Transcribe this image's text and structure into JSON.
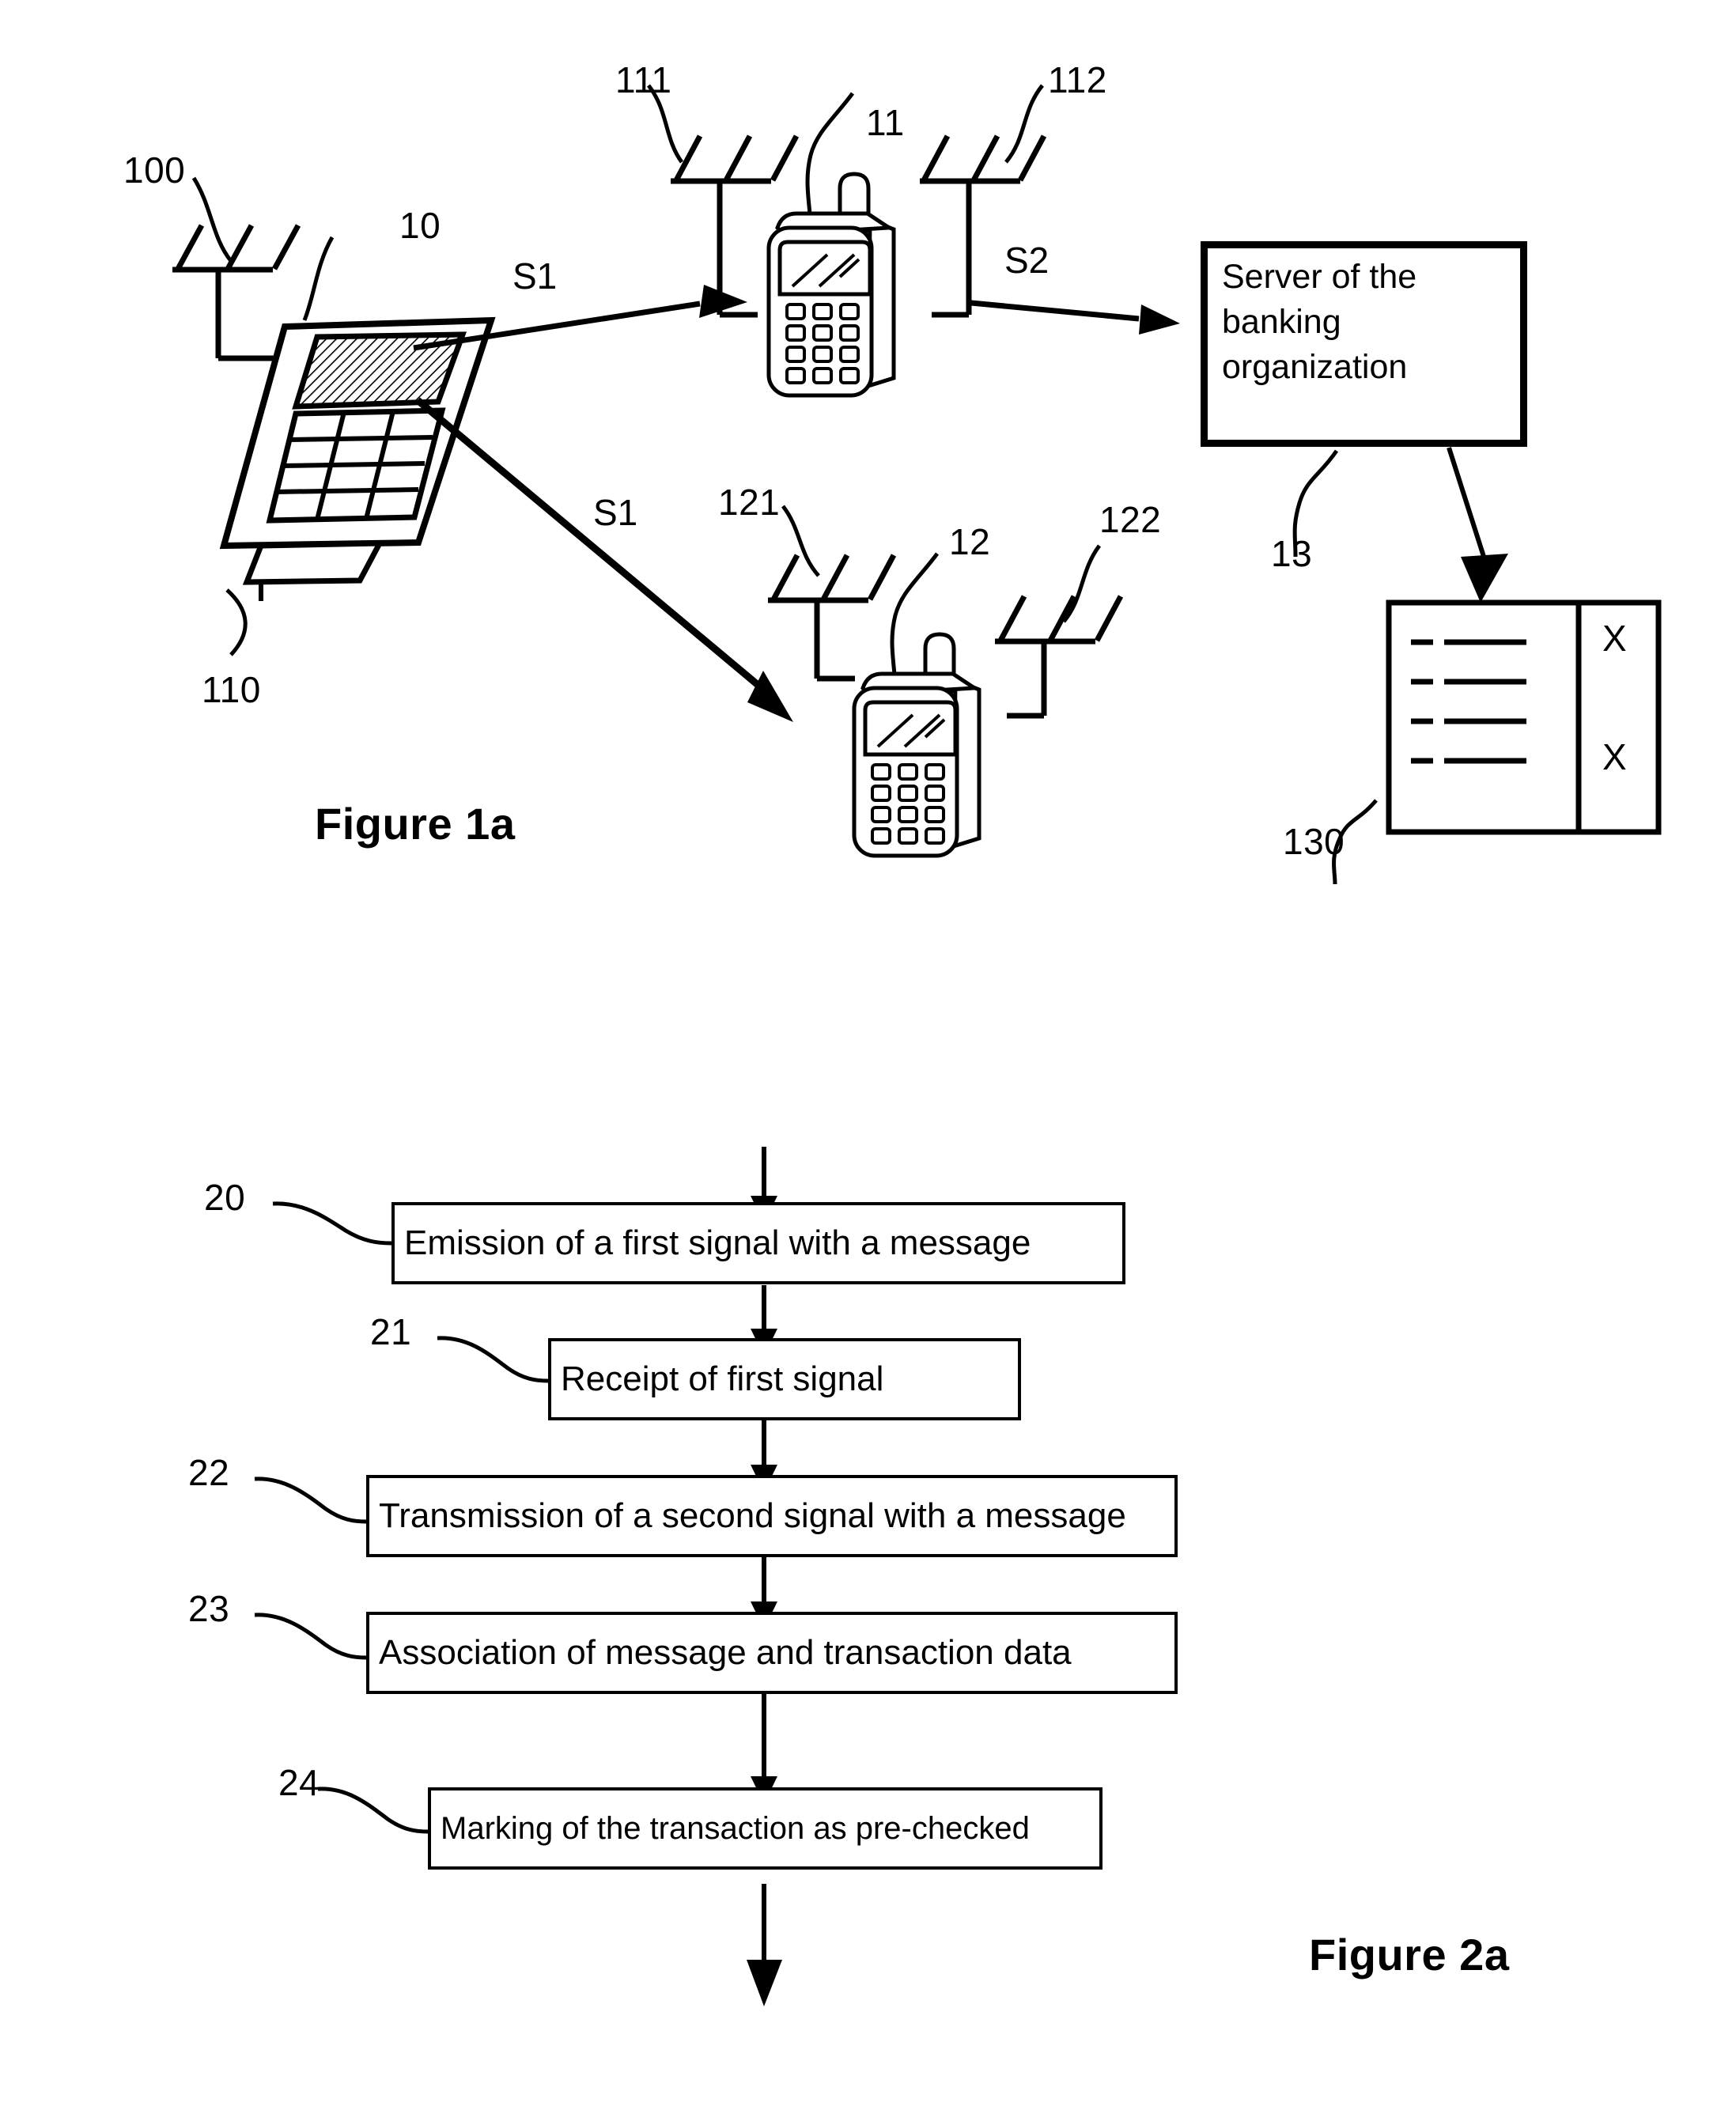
{
  "figure1": {
    "caption": "Figure 1a",
    "reference_numbers": {
      "card_reader_antenna": "100",
      "card_reader": "10",
      "card_reader_cable": "110",
      "phone1": "11",
      "phone1_antenna_left": "111",
      "phone1_antenna_right": "112",
      "phone2": "12",
      "phone2_antenna_left": "121",
      "phone2_antenna_right": "122",
      "server": "13",
      "table": "130"
    },
    "signals": {
      "s1_top": "S1",
      "s1_bottom": "S1",
      "s2": "S2"
    },
    "server_box": {
      "text": "Server of the\nbanking\norganization"
    },
    "table": {
      "rows": 4,
      "marks": [
        "X",
        "X"
      ]
    }
  },
  "figure2": {
    "caption": "Figure 2a",
    "steps": [
      {
        "ref": "20",
        "label": "Emission of a first signal with a message"
      },
      {
        "ref": "21",
        "label": "Receipt of first signal"
      },
      {
        "ref": "22",
        "label": "Transmission of a second signal with a message"
      },
      {
        "ref": "23",
        "label": "Association of message and transaction data"
      },
      {
        "ref": "24",
        "label": "Marking of the transaction as pre-checked"
      }
    ]
  },
  "colors": {
    "ink": "#000000",
    "paper": "#ffffff"
  }
}
